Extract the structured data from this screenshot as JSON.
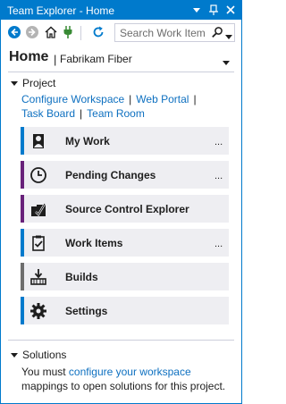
{
  "window": {
    "title": "Team Explorer - Home",
    "accent": "#007acc"
  },
  "toolbar": {
    "search_placeholder": "Search Work Items"
  },
  "header": {
    "title": "Home",
    "separator": "|",
    "project": "Fabrikam Fiber"
  },
  "project_section": {
    "title": "Project",
    "links": [
      "Configure Workspace",
      "Web Portal",
      "Task Board",
      "Team Room"
    ],
    "link_separator": "|"
  },
  "tiles": [
    {
      "label": "My Work",
      "more": "...",
      "accent": "#007acc",
      "icon": "person-icon"
    },
    {
      "label": "Pending Changes",
      "more": "...",
      "accent": "#68217a",
      "icon": "clock-icon"
    },
    {
      "label": "Source Control Explorer",
      "more": "",
      "accent": "#68217a",
      "icon": "source-control-icon"
    },
    {
      "label": "Work Items",
      "more": "...",
      "accent": "#007acc",
      "icon": "clipboard-check-icon"
    },
    {
      "label": "Builds",
      "more": "",
      "accent": "#6d6d6d",
      "icon": "builds-icon"
    },
    {
      "label": "Settings",
      "more": "",
      "accent": "#007acc",
      "icon": "gear-icon"
    }
  ],
  "solutions_section": {
    "title": "Solutions",
    "text_before": "You must ",
    "link": "configure your workspace",
    "text_after": " mappings to open solutions for this project."
  },
  "colors": {
    "link": "#0e70c0",
    "tile_bg": "#eeeef2",
    "text": "#1e1e1e"
  }
}
